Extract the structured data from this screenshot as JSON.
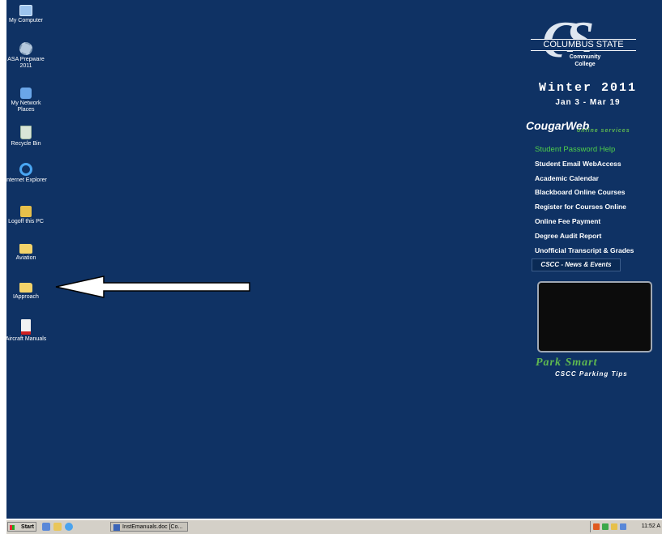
{
  "desktop_icons": [
    {
      "name": "My Computer",
      "icon": "computer-icon"
    },
    {
      "name": "ASA Prepware 2011",
      "icon": "gear-icon"
    },
    {
      "name": "My Network Places",
      "icon": "network-icon"
    },
    {
      "name": "Recycle Bin",
      "icon": "recycle-bin-icon"
    },
    {
      "name": "Internet Explorer",
      "icon": "ie-icon"
    },
    {
      "name": "Logoff this PC",
      "icon": "key-icon"
    },
    {
      "name": "Aviation",
      "icon": "folder-icon"
    },
    {
      "name": "IApproach",
      "icon": "folder-icon"
    },
    {
      "name": "Aircraft Manuals",
      "icon": "pdf-icon"
    }
  ],
  "college_panel": {
    "logo_letters": "CS",
    "logo_name": "COLUMBUS STATE",
    "logo_sub": "Community College",
    "season": "Winter 2011",
    "dates": "Jan 3 - Mar 19",
    "portal_name": "CougarWeb",
    "portal_tagline": "online services",
    "links": [
      "Student Password Help",
      "Student Email WebAccess",
      "Academic Calendar",
      "Blackboard Online Courses",
      "Register for Courses Online",
      "Online Fee Payment",
      "Degree Audit Report",
      "Unofficial Transcript & Grades"
    ],
    "news_label": "CSCC - News & Events",
    "park_title": "Park Smart",
    "park_sub": "CSCC Parking Tips"
  },
  "taskbar": {
    "start_label": "Start",
    "task_label": "InstEmanuals.doc [Co...",
    "clock": "11:52 A"
  },
  "colors": {
    "desktop_bg": "#0f3264",
    "link_green": "#4fd14a",
    "taskbar_bg": "#d4d0c8"
  }
}
